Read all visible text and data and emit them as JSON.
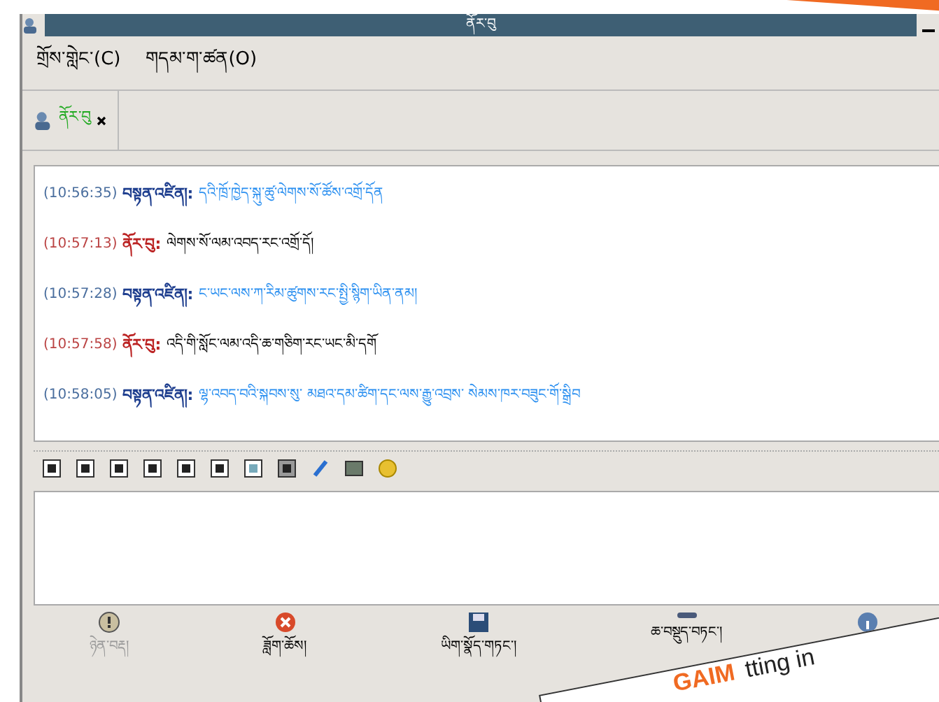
{
  "window": {
    "title": "ནོར་བུ"
  },
  "menu": [
    {
      "label": "གྲོས་གླེང་(C)"
    },
    {
      "label": "གདམ་ག་ཚན(O)"
    }
  ],
  "tabs": [
    {
      "label": "ནོར་བུ",
      "selected": true
    }
  ],
  "messages": [
    {
      "time": "(10:56:35)",
      "sender": "བསྟན་འཛིན།:",
      "kind": "incoming",
      "text": "དའི་ཁྲོ་ཁྱེད་སྐུ་ཚུ་ལེགས་སོ་ཚོས་འགྲོ་དོན"
    },
    {
      "time": "(10:57:13)",
      "sender": "ནོར་བུ:",
      "kind": "outgoing",
      "text": "ལེགས་སོ་ལམ་འབད་རང་འགྲོ་དོ།"
    },
    {
      "time": "(10:57:28)",
      "sender": "བསྟན་འཛིན།:",
      "kind": "incoming",
      "text": "ང་ཡང་ལས་ཀ་རིམ་ཚུགས་རང་སྤྱི་སྙིག་ཡིན་ནམ།"
    },
    {
      "time": "(10:57:58)",
      "sender": "ནོར་བུ:",
      "kind": "outgoing",
      "text": "འདི་གི་སློང་ལམ་འདི་ཆ་གཅིག་རང་ཡང་མི་དགོ"
    },
    {
      "time": "(10:58:05)",
      "sender": "བསྟན་འཛིན།:",
      "kind": "incoming",
      "text": "ལྷ་འབད་བའི་སྐབས་སུ་ མཐའ་དམ་ཚིག་དང་ལས་རྒྱུ་འབྲས་ སེམས་ཁར་བཟུང་གོ་སྒྲིབ"
    }
  ],
  "actions": [
    {
      "kind": "warn",
      "label": "ཉེན་བརྡ།",
      "disabled": true
    },
    {
      "kind": "block",
      "label": "ཟློག་ཆོས།",
      "disabled": false
    },
    {
      "kind": "file",
      "label": "ཡིག་སྣོད་གཏང་།",
      "disabled": false
    },
    {
      "kind": "remove",
      "label": "ཆ་བསྡུད་བཏང་།",
      "disabled": false
    },
    {
      "kind": "info"
    }
  ],
  "sticker": {
    "title": "GAIM",
    "text": "tting in"
  }
}
